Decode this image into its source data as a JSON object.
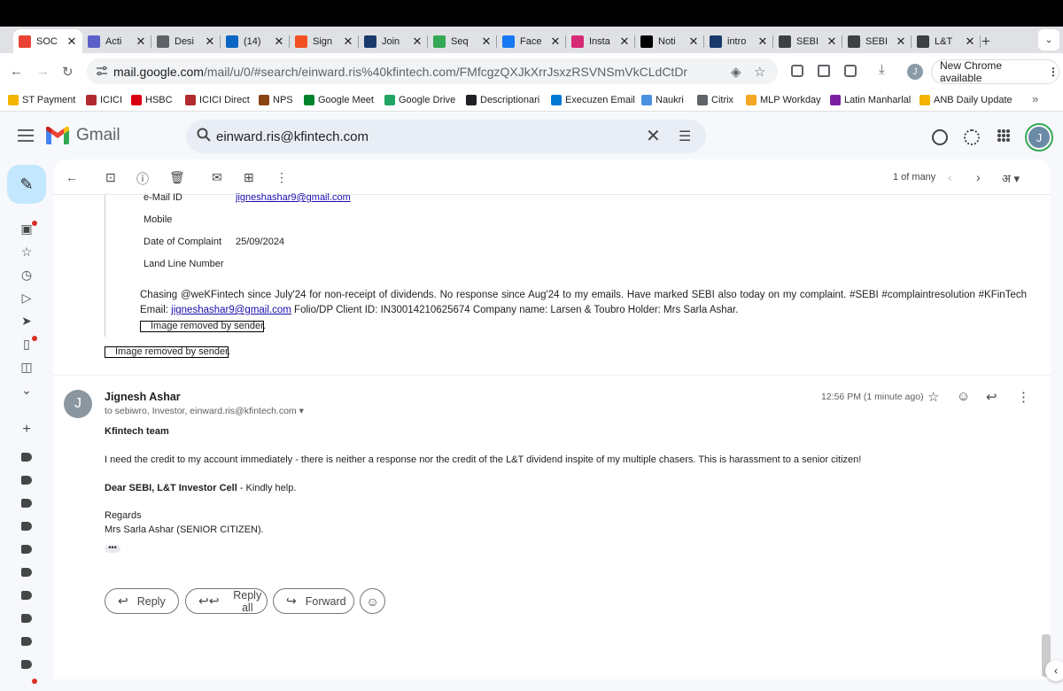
{
  "tabs": [
    {
      "label": "SOC",
      "icon": "gmail-icon",
      "color": "#ea4335",
      "active": true
    },
    {
      "label": "Acti",
      "icon": "teams-icon",
      "color": "#5b5fc7"
    },
    {
      "label": "Desi",
      "icon": "globe-icon",
      "color": "#5f6368"
    },
    {
      "label": "(14)",
      "icon": "linkedin-icon",
      "color": "#0a66c2"
    },
    {
      "label": "Sign",
      "icon": "microsoft-icon",
      "color": "#f25022"
    },
    {
      "label": "Join",
      "icon": "mail-icon",
      "color": "#1a3a6b"
    },
    {
      "label": "Seq",
      "icon": "chart-icon",
      "color": "#34a853"
    },
    {
      "label": "Face",
      "icon": "facebook-icon",
      "color": "#1877f2"
    },
    {
      "label": "Insta",
      "icon": "instagram-icon",
      "color": "#d62976"
    },
    {
      "label": "Noti",
      "icon": "x-icon",
      "color": "#000000"
    },
    {
      "label": "intro",
      "icon": "mail-icon",
      "color": "#1a3a6b"
    },
    {
      "label": "SEBI",
      "icon": "document-icon",
      "color": "#3c4043"
    },
    {
      "label": "SEBI",
      "icon": "document-icon",
      "color": "#3c4043"
    },
    {
      "label": "L&T",
      "icon": "globe-icon",
      "color": "#3c4043"
    }
  ],
  "browser": {
    "url_host": "mail.google.com",
    "url_path": "/mail/u/0/#search/einward.ris%40kfintech.com/FMfcgzQXJkXrrJsxzRSVNSmVkCLdCtDr",
    "new_chrome": "New Chrome available",
    "profile_initial": "J"
  },
  "bookmarks": [
    {
      "label": "ST Payment",
      "color": "#f4b400"
    },
    {
      "label": "ICICI",
      "color": "#b02a30"
    },
    {
      "label": "HSBC",
      "color": "#db0011"
    },
    {
      "label": "ICICI Direct",
      "color": "#b02a30"
    },
    {
      "label": "NPS",
      "color": "#8b4513"
    },
    {
      "label": "Google Meet",
      "color": "#00832d"
    },
    {
      "label": "Google Drive",
      "color": "#1fa463"
    },
    {
      "label": "Descriptionari",
      "color": "#202124"
    },
    {
      "label": "Execuzen Email",
      "color": "#0078d4"
    },
    {
      "label": "Naukri",
      "color": "#4a90e2"
    },
    {
      "label": "Citrix",
      "color": "#5f6368"
    },
    {
      "label": "MLP Workday",
      "color": "#f5a623"
    },
    {
      "label": "Latin Manharlal",
      "color": "#7b1fa2"
    },
    {
      "label": "ANB Daily Update",
      "color": "#f4b400"
    }
  ],
  "gmail": {
    "brand": "Gmail",
    "search_value": "einward.ris@kfintech.com",
    "counter": "1 of many",
    "lang_glyph": "अ"
  },
  "quoted": {
    "email_label": "e-Mail ID",
    "email_value": "jigneshashar9@gmail.com",
    "mobile_label": "Mobile",
    "date_label": "Date of Complaint",
    "date_value": "25/09/2024",
    "landline_label": "Land Line Number",
    "text_before_link": "Chasing @weKFintech since July'24 for non-receipt of dividends. No response since Aug'24 to my emails. Have marked SEBI also today on my complaint. #SEBI #complaintresolution #KFinTech Email:",
    "link_text": "jigneshashar9@gmail.com",
    "text_after_link": " Folio/DP Client ID: IN30014210625674 Company name: Larsen & Toubro Holder: Mrs Sarla Ashar.",
    "img_removed_1": "Image removed by sender.",
    "img_removed_2": "Image removed by sender."
  },
  "message": {
    "avatar_initial": "J",
    "sender": "Jignesh Ashar",
    "recipients": "to sebiwro, Investor, einward.ris@kfintech.com",
    "time": "12:56 PM (1 minute ago)",
    "greeting": "Kfintech team",
    "para1": "I need the credit to my account immediately - there is neither a response nor the credit of the L&T dividend inspite of my multiple chasers. This is harassment to a senior citizen!",
    "para2_bold": "Dear SEBI, L&T Investor Cell",
    "para2_rest": " - Kindly help.",
    "regards": "Regards",
    "signature": "Mrs Sarla Ashar (SENIOR CITIZEN)."
  },
  "actions": {
    "reply": "Reply",
    "reply_all": "Reply all",
    "forward": "Forward"
  }
}
